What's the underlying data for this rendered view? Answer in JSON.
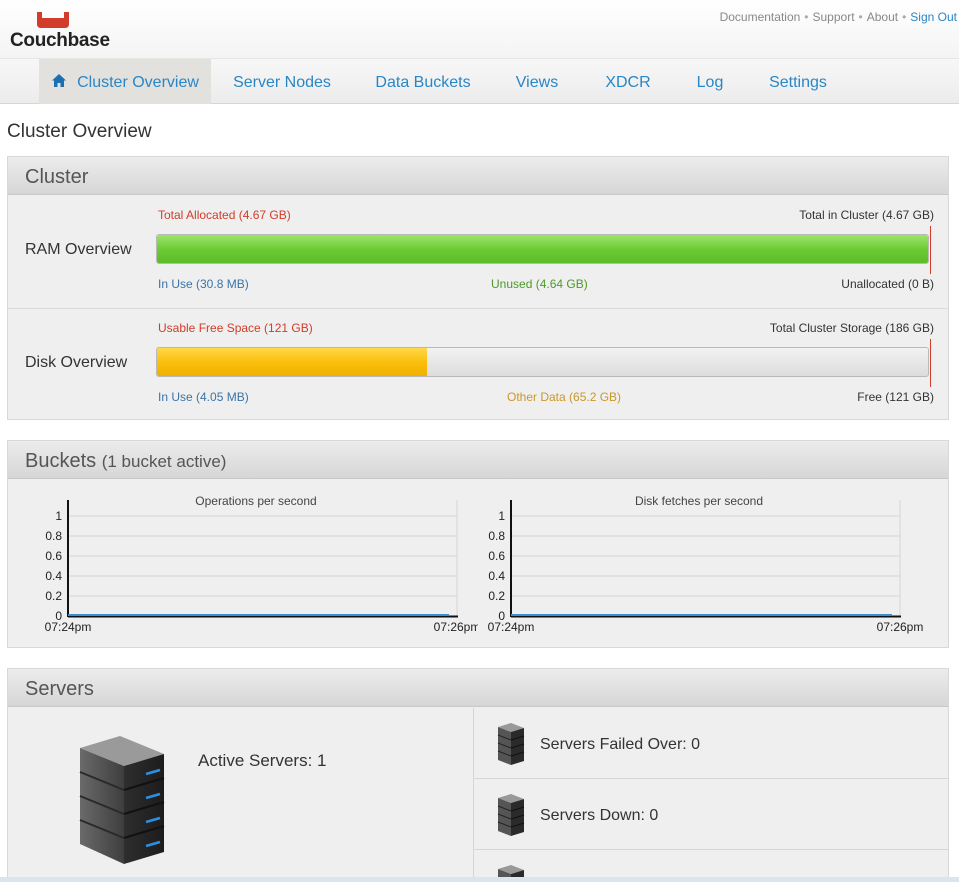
{
  "brand": {
    "name": "Couchbase",
    "accent": "#d23c2a"
  },
  "toplinks": {
    "documentation": "Documentation",
    "support": "Support",
    "about": "About",
    "signout": "Sign Out",
    "separator": "•"
  },
  "nav": {
    "tabs": [
      {
        "label": "Cluster Overview",
        "icon": "home-icon",
        "active": true
      },
      {
        "label": "Server Nodes"
      },
      {
        "label": "Data Buckets"
      },
      {
        "label": "Views"
      },
      {
        "label": "XDCR"
      },
      {
        "label": "Log"
      },
      {
        "label": "Settings"
      }
    ]
  },
  "page_title": "Cluster Overview",
  "cluster": {
    "title": "Cluster",
    "ram": {
      "label": "RAM Overview",
      "total_allocated": "Total Allocated (4.67 GB)",
      "total_in_cluster": "Total in Cluster (4.67 GB)",
      "in_use": "In Use (30.8 MB)",
      "unused": "Unused (4.64 GB)",
      "unallocated": "Unallocated (0 B)",
      "fill_fraction": 1.0,
      "colors": {
        "fill": "#6dcc35"
      }
    },
    "disk": {
      "label": "Disk Overview",
      "usable_free": "Usable Free Space (121 GB)",
      "total_storage": "Total Cluster Storage (186 GB)",
      "in_use": "In Use (4.05 MB)",
      "other_data": "Other Data (65.2 GB)",
      "free": "Free (121 GB)",
      "fill_fraction": 0.35,
      "colors": {
        "fill": "#fbbf0c"
      }
    }
  },
  "buckets": {
    "title": "Buckets",
    "subtitle": "(1 bucket active)"
  },
  "chart_data": [
    {
      "type": "line",
      "title": "Operations per second",
      "x": [
        "07:24pm",
        "07:26pm"
      ],
      "yticks": [
        "1",
        "0.8",
        "0.6",
        "0.4",
        "0.2",
        "0"
      ],
      "ylim": [
        0,
        1
      ],
      "series": [
        {
          "values": [
            0,
            0
          ]
        }
      ],
      "grid": true,
      "series_color": "#3a8fcf"
    },
    {
      "type": "line",
      "title": "Disk fetches per second",
      "x": [
        "07:24pm",
        "07:26pm"
      ],
      "yticks": [
        "1",
        "0.8",
        "0.6",
        "0.4",
        "0.2",
        "0"
      ],
      "ylim": [
        0,
        1
      ],
      "series": [
        {
          "values": [
            0,
            0
          ]
        }
      ],
      "grid": true,
      "series_color": "#3a8fcf"
    }
  ],
  "servers": {
    "title": "Servers",
    "active": "Active Servers: 1",
    "failed_over": "Servers Failed Over: 0",
    "down": "Servers Down: 0"
  }
}
